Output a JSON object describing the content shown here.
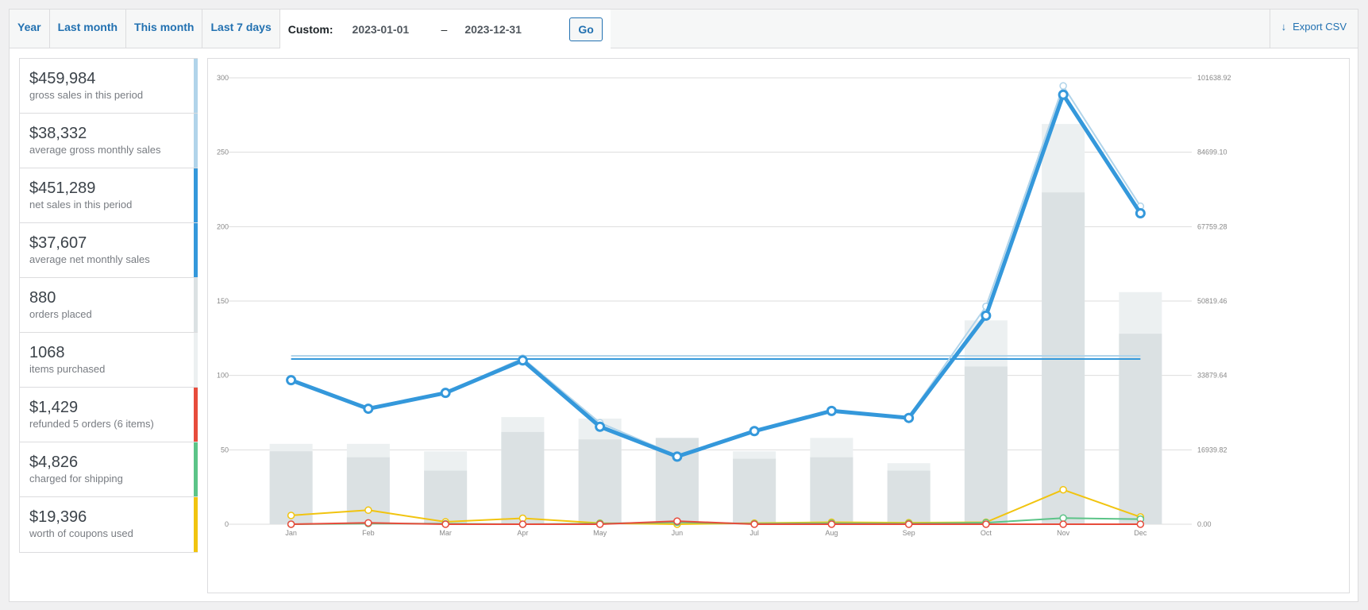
{
  "filters": {
    "tabs": [
      "Year",
      "Last month",
      "This month",
      "Last 7 days"
    ],
    "custom_label": "Custom:",
    "start_date": "2023-01-01",
    "end_date": "2023-12-31",
    "separator": "–",
    "go_label": "Go",
    "export_label": "Export CSV"
  },
  "legend": [
    {
      "value": "$459,984",
      "label": "gross sales in this period",
      "color": "#b1d4ea"
    },
    {
      "value": "$38,332",
      "label": "average gross monthly sales",
      "color": "#b1d4ea"
    },
    {
      "value": "$451,289",
      "label": "net sales in this period",
      "color": "#3498db"
    },
    {
      "value": "$37,607",
      "label": "average net monthly sales",
      "color": "#3498db"
    },
    {
      "value": "880",
      "label": "orders placed",
      "color": "#dbe1e3"
    },
    {
      "value": "1068",
      "label": "items purchased",
      "color": "#ecf0f1"
    },
    {
      "value": "$1,429",
      "label": "refunded 5 orders (6 items)",
      "color": "#e74c3c"
    },
    {
      "value": "$4,826",
      "label": "charged for shipping",
      "color": "#5cc488"
    },
    {
      "value": "$19,396",
      "label": "worth of coupons used",
      "color": "#f1c40f"
    }
  ],
  "chart_data": {
    "type": "bar+line",
    "categories": [
      "Jan",
      "Feb",
      "Mar",
      "Apr",
      "May",
      "Jun",
      "Jul",
      "Aug",
      "Sep",
      "Oct",
      "Nov",
      "Dec"
    ],
    "y_left_ticks": [
      "0",
      "50",
      "100",
      "150",
      "200",
      "250",
      "300"
    ],
    "y_right_ticks": [
      "0.00",
      "16939.82",
      "33879.64",
      "50819.46",
      "67759.28",
      "84699.10",
      "101638.92"
    ],
    "ylim_left": [
      0,
      300
    ],
    "ylim_right": [
      0,
      101638.92
    ],
    "grid": true,
    "series": [
      {
        "kind": "bar",
        "axis": "left",
        "color": "#ecf0f1",
        "values": [
          54,
          54,
          49,
          72,
          71,
          58,
          49,
          58,
          41,
          137,
          269,
          156
        ]
      },
      {
        "kind": "bar",
        "axis": "left",
        "color": "#dbe1e3",
        "values": [
          49,
          45,
          36,
          62,
          57,
          58,
          44,
          45,
          36,
          106,
          223,
          128
        ]
      },
      {
        "kind": "line",
        "axis": "right",
        "color": "#b1d4ea",
        "width": 2,
        "values": [
          32800,
          26600,
          30000,
          37800,
          23100,
          15600,
          21200,
          25800,
          24500,
          49600,
          99800,
          72400
        ]
      },
      {
        "kind": "line",
        "axis": "right",
        "color": "#3498db",
        "width": 5,
        "values": [
          32800,
          26300,
          29900,
          37300,
          22200,
          15400,
          21200,
          25800,
          24200,
          47500,
          97800,
          70800
        ]
      },
      {
        "kind": "line",
        "axis": "right",
        "color": "#f1c40f",
        "width": 2,
        "values": [
          2000,
          3200,
          550,
          1350,
          250,
          0,
          250,
          450,
          350,
          450,
          7850,
          1650
        ]
      },
      {
        "kind": "line",
        "axis": "right",
        "color": "#5cc488",
        "width": 2,
        "values": [
          0,
          150,
          100,
          0,
          150,
          450,
          100,
          200,
          150,
          350,
          1400,
          1150
        ]
      },
      {
        "kind": "line",
        "axis": "right",
        "color": "#e74c3c",
        "width": 2,
        "values": [
          0,
          300,
          0,
          0,
          0,
          700,
          0,
          0,
          0,
          0,
          0,
          0
        ]
      }
    ],
    "averages": [
      {
        "color": "#b1d4ea",
        "value": 38332
      },
      {
        "color": "#3498db",
        "value": 37607
      }
    ]
  }
}
